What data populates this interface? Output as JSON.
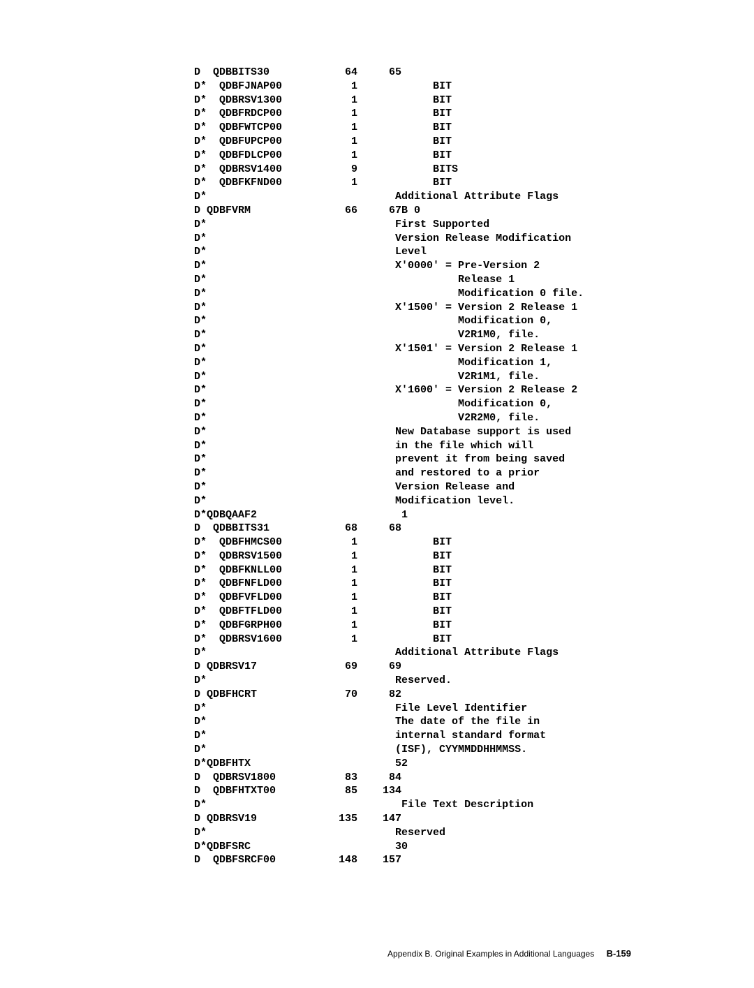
{
  "lines": [
    "D  QDBBITS30            64     65",
    "D*  QDBFJNAP00           1            BIT",
    "D*  QDBRSV1300           1            BIT",
    "D*  QDBFRDCP00           1            BIT",
    "D*  QDBFWTCP00           1            BIT",
    "D*  QDBFUPCP00           1            BIT",
    "D*  QDBFDLCP00           1            BIT",
    "D*  QDBRSV1400           9            BITS",
    "D*  QDBFKFND00           1            BIT",
    "D*                              Additional Attribute Flags",
    "D QDBFVRM               66     67B 0",
    "D*                              First Supported",
    "D*                              Version Release Modification",
    "D*                              Level",
    "D*                              X'0000' = Pre-Version 2",
    "D*                                        Release 1",
    "D*                                        Modification 0 file.",
    "D*                              X'1500' = Version 2 Release 1",
    "D*                                        Modification 0,",
    "D*                                        V2R1M0, file.",
    "D*                              X'1501' = Version 2 Release 1",
    "D*                                        Modification 1,",
    "D*                                        V2R1M1, file.",
    "D*                              X'1600' = Version 2 Release 2",
    "D*                                        Modification 0,",
    "D*                                        V2R2M0, file.",
    "D*                              New Database support is used",
    "D*                              in the file which will",
    "D*                              prevent it from being saved",
    "D*                              and restored to a prior",
    "D*                              Version Release and",
    "D*                              Modification level.",
    "D*QDBQAAF2                       1",
    "D  QDBBITS31            68     68",
    "D*  QDBFHMCS00           1            BIT",
    "D*  QDBRSV1500           1            BIT",
    "D*  QDBFKNLL00           1            BIT",
    "D*  QDBFNFLD00           1            BIT",
    "D*  QDBFVFLD00           1            BIT",
    "D*  QDBFTFLD00           1            BIT",
    "D*  QDBFGRPH00           1            BIT",
    "D*  QDBRSV1600           1            BIT",
    "D*                              Additional Attribute Flags",
    "D QDBRSV17              69     69",
    "D*                              Reserved.",
    "D QDBFHCRT              70     82",
    "D*                              File Level Identifier",
    "D*                              The date of the file in",
    "D*                              internal standard format",
    "D*                              (ISF), CYYMMDDHHMMSS.",
    "D*QDBFHTX                       52",
    "D  QDBRSV1800           83     84",
    "D  QDBFHTXT00           85    134",
    "D*                               File Text Description",
    "D QDBRSV19             135    147",
    "D*                              Reserved",
    "D*QDBFSRC                       30",
    "D  QDBFSRCF00          148    157"
  ],
  "footer_text": "Appendix B. Original Examples in Additional Languages",
  "page_number": "B-159"
}
